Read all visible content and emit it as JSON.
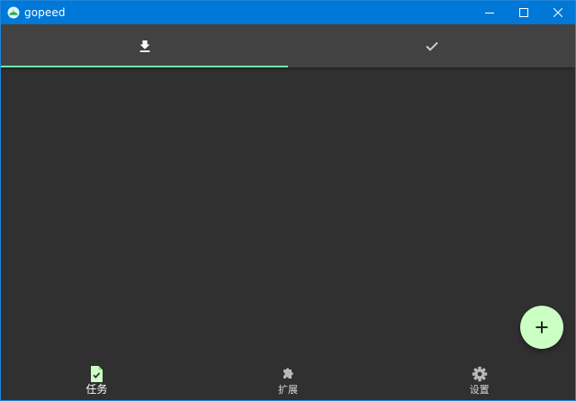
{
  "window": {
    "title": "gopeed"
  },
  "tabs": [
    {
      "icon": "download-icon",
      "active": true
    },
    {
      "icon": "check-icon",
      "active": false
    }
  ],
  "fab": {
    "icon": "plus-icon"
  },
  "bottom_nav": {
    "items": [
      {
        "label": "任务",
        "icon": "task-file-icon",
        "active": true
      },
      {
        "label": "扩展",
        "icon": "puzzle-icon",
        "active": false
      },
      {
        "label": "设置",
        "icon": "gear-icon",
        "active": false
      }
    ]
  },
  "colors": {
    "titlebar": "#0078d7",
    "tabbar": "#424242",
    "content_bg": "#303030",
    "tab_indicator": "#69f0ae",
    "fab_bg": "#ccffc4",
    "active_nav_icon": "#ccffc4",
    "inactive_nav_icon": "#b8b8b8"
  }
}
